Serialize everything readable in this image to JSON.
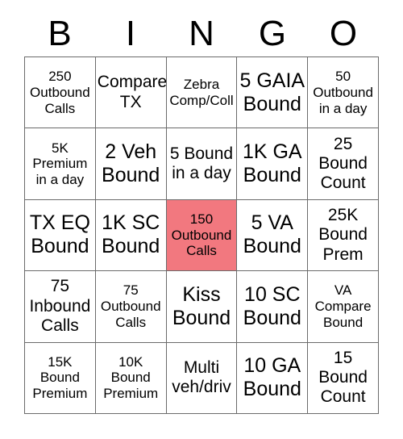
{
  "card": {
    "title": "BINGO",
    "header_letters": [
      "B",
      "I",
      "N",
      "G",
      "O"
    ],
    "marked_color": "#f2787f",
    "border_color": "#6b6b6b",
    "background_color": "#ffffff",
    "text_color": "#000000",
    "rows": 5,
    "columns": 5,
    "cells": [
      {
        "text": "250\nOutbound\nCalls",
        "marked": false,
        "size": "sm"
      },
      {
        "text": "Compare\nTX",
        "marked": false,
        "size": "md"
      },
      {
        "text": "Zebra\nComp/Coll",
        "marked": false,
        "size": "sm"
      },
      {
        "text": "5 GAIA\nBound",
        "marked": false,
        "size": "lg"
      },
      {
        "text": "50\nOutbound\nin a day",
        "marked": false,
        "size": "sm"
      },
      {
        "text": "5K\nPremium\nin a day",
        "marked": false,
        "size": "sm"
      },
      {
        "text": "2 Veh\nBound",
        "marked": false,
        "size": "lg"
      },
      {
        "text": "5 Bound\nin a day",
        "marked": false,
        "size": "md"
      },
      {
        "text": "1K GA\nBound",
        "marked": false,
        "size": "lg"
      },
      {
        "text": "25\nBound\nCount",
        "marked": false,
        "size": "md"
      },
      {
        "text": "TX EQ\nBound",
        "marked": false,
        "size": "lg"
      },
      {
        "text": "1K SC\nBound",
        "marked": false,
        "size": "lg"
      },
      {
        "text": "150\nOutbound\nCalls",
        "marked": true,
        "size": "sm"
      },
      {
        "text": "5 VA\nBound",
        "marked": false,
        "size": "lg"
      },
      {
        "text": "25K\nBound\nPrem",
        "marked": false,
        "size": "md"
      },
      {
        "text": "75\nInbound\nCalls",
        "marked": false,
        "size": "md"
      },
      {
        "text": "75\nOutbound\nCalls",
        "marked": false,
        "size": "sm"
      },
      {
        "text": "Kiss\nBound",
        "marked": false,
        "size": "lg"
      },
      {
        "text": "10 SC\nBound",
        "marked": false,
        "size": "lg"
      },
      {
        "text": "VA\nCompare\nBound",
        "marked": false,
        "size": "sm"
      },
      {
        "text": "15K\nBound\nPremium",
        "marked": false,
        "size": "sm"
      },
      {
        "text": "10K\nBound\nPremium",
        "marked": false,
        "size": "sm"
      },
      {
        "text": "Multi\nveh/driv",
        "marked": false,
        "size": "md"
      },
      {
        "text": "10 GA\nBound",
        "marked": false,
        "size": "lg"
      },
      {
        "text": "15\nBound\nCount",
        "marked": false,
        "size": "md"
      }
    ]
  }
}
